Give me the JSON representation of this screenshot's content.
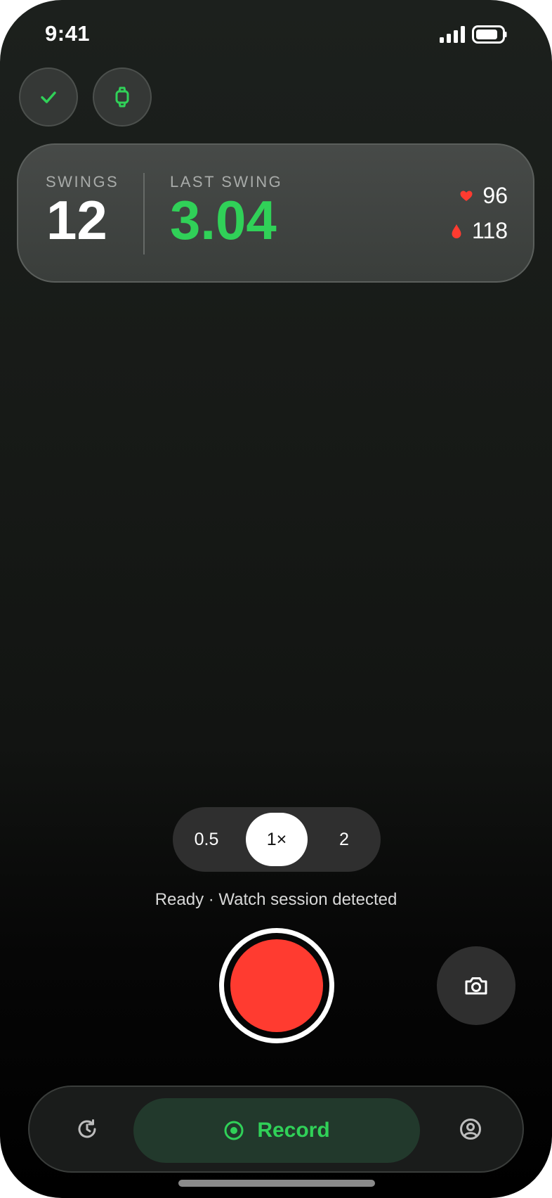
{
  "status_bar": {
    "time": "9:41"
  },
  "stats": {
    "swings_label": "SWINGS",
    "swings_value": "12",
    "last_swing_label": "LAST SWING",
    "last_swing_value": "3.04",
    "heart_rate": "96",
    "blood_value": "118"
  },
  "zoom": {
    "options": [
      "0.5",
      "1×",
      "2"
    ],
    "selected": "1×"
  },
  "status_message": "Ready · Watch session detected",
  "tab_bar": {
    "record_label": "Record"
  },
  "colors": {
    "accent_green": "#30d158",
    "record_red": "#ff3b30",
    "card_bg": "#3f4340"
  },
  "icons": {
    "top_left": "check-icon",
    "top_second": "watch-icon",
    "heart": "heart-icon",
    "blood": "drop-icon",
    "camera": "camera-icon",
    "history": "history-icon",
    "record": "record-dot-icon",
    "profile": "profile-icon"
  }
}
